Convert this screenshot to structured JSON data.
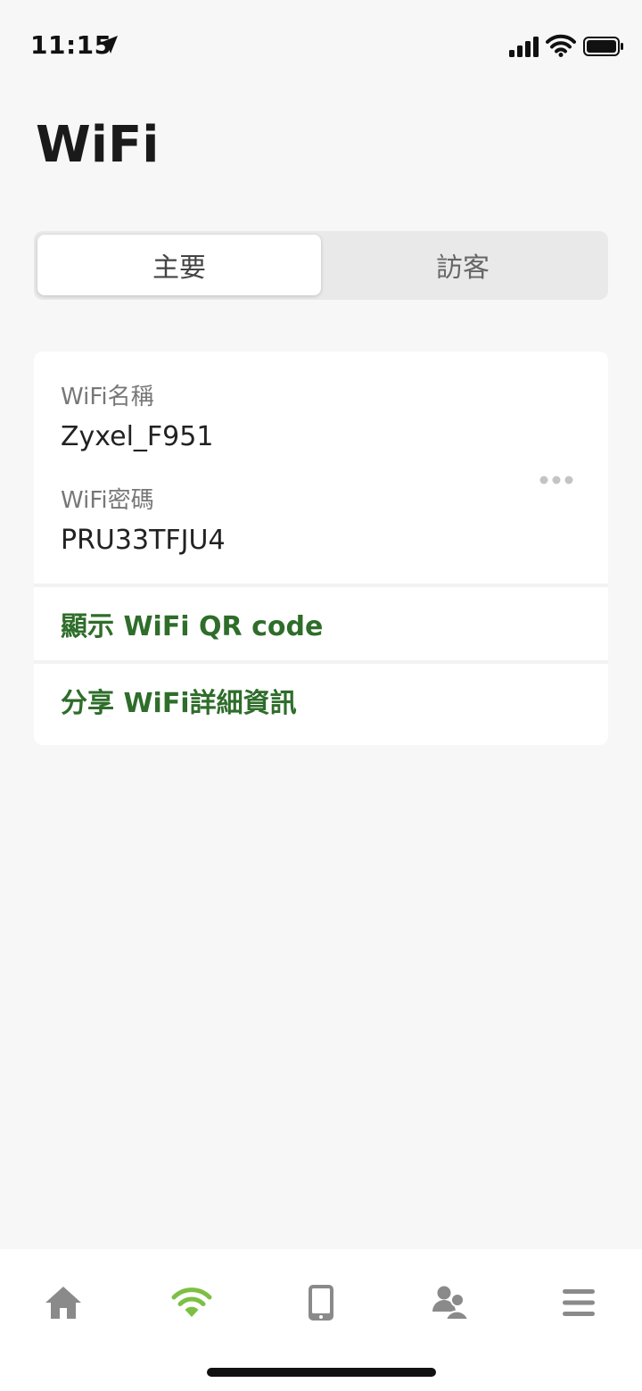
{
  "status_bar": {
    "time": "11:15"
  },
  "header": {
    "title": "WiFi"
  },
  "segment": {
    "options": [
      "主要",
      "訪客"
    ],
    "selected": "主要"
  },
  "card": {
    "name_label": "WiFi名稱",
    "name_value": "Zyxel_F951",
    "password_label": "WiFi密碼",
    "password_value": "PRU33TFJU4",
    "actions": [
      "顯示 WiFi QR code",
      "分享 WiFi詳細資訊"
    ]
  },
  "tab_bar": {
    "tabs": [
      {
        "icon": "home-icon",
        "selected": false
      },
      {
        "icon": "wifi-icon",
        "selected": true
      },
      {
        "icon": "devices-icon",
        "selected": false
      },
      {
        "icon": "users-icon",
        "selected": false
      },
      {
        "icon": "menu-icon",
        "selected": false
      }
    ]
  },
  "colors": {
    "accent": "#7cc043",
    "link": "#2e6d2a",
    "icon_gray": "#8a8a8a"
  }
}
